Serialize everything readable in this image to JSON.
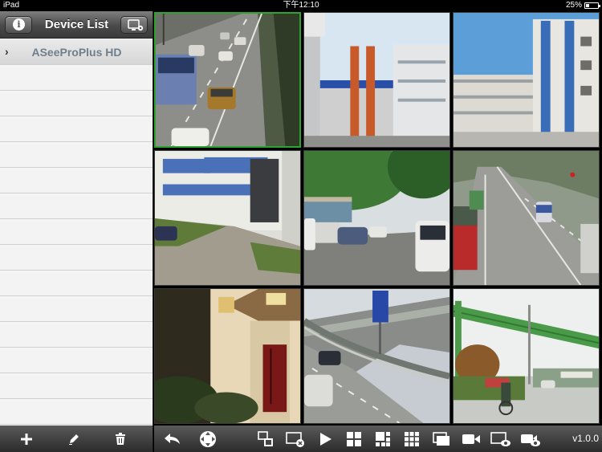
{
  "status_bar": {
    "device": "iPad",
    "time": "下午12:10",
    "battery": "25%",
    "battery_level": 0.25
  },
  "sidebar": {
    "title": "Device List",
    "devices": [
      {
        "name": "ASeeProPlus HD"
      }
    ]
  },
  "grid": {
    "selected_index": 0,
    "cells": [
      {
        "scene": "highway-traffic"
      },
      {
        "scene": "building-gate"
      },
      {
        "scene": "apartment-buildings"
      },
      {
        "scene": "office-courtyard"
      },
      {
        "scene": "parking-street"
      },
      {
        "scene": "highway-trucks"
      },
      {
        "scene": "house-entrance"
      },
      {
        "scene": "overpass-road"
      },
      {
        "scene": "toll-gate-road"
      }
    ]
  },
  "toolbar": {
    "version": "v1.0.0",
    "icons": [
      "back-icon",
      "ptz-icon",
      "channel-switch-icon",
      "close-stream-icon",
      "play-icon",
      "layout-4-icon",
      "layout-6-icon",
      "layout-9-icon",
      "fullscreen-icon",
      "record-icon",
      "snapshot-icon",
      "playback-icon"
    ]
  },
  "side_toolbar": {
    "icons": [
      "add-icon",
      "edit-icon",
      "delete-icon"
    ]
  },
  "colors": {
    "selected_border": "#2ea42e",
    "device_label": "#6f7f8c"
  }
}
